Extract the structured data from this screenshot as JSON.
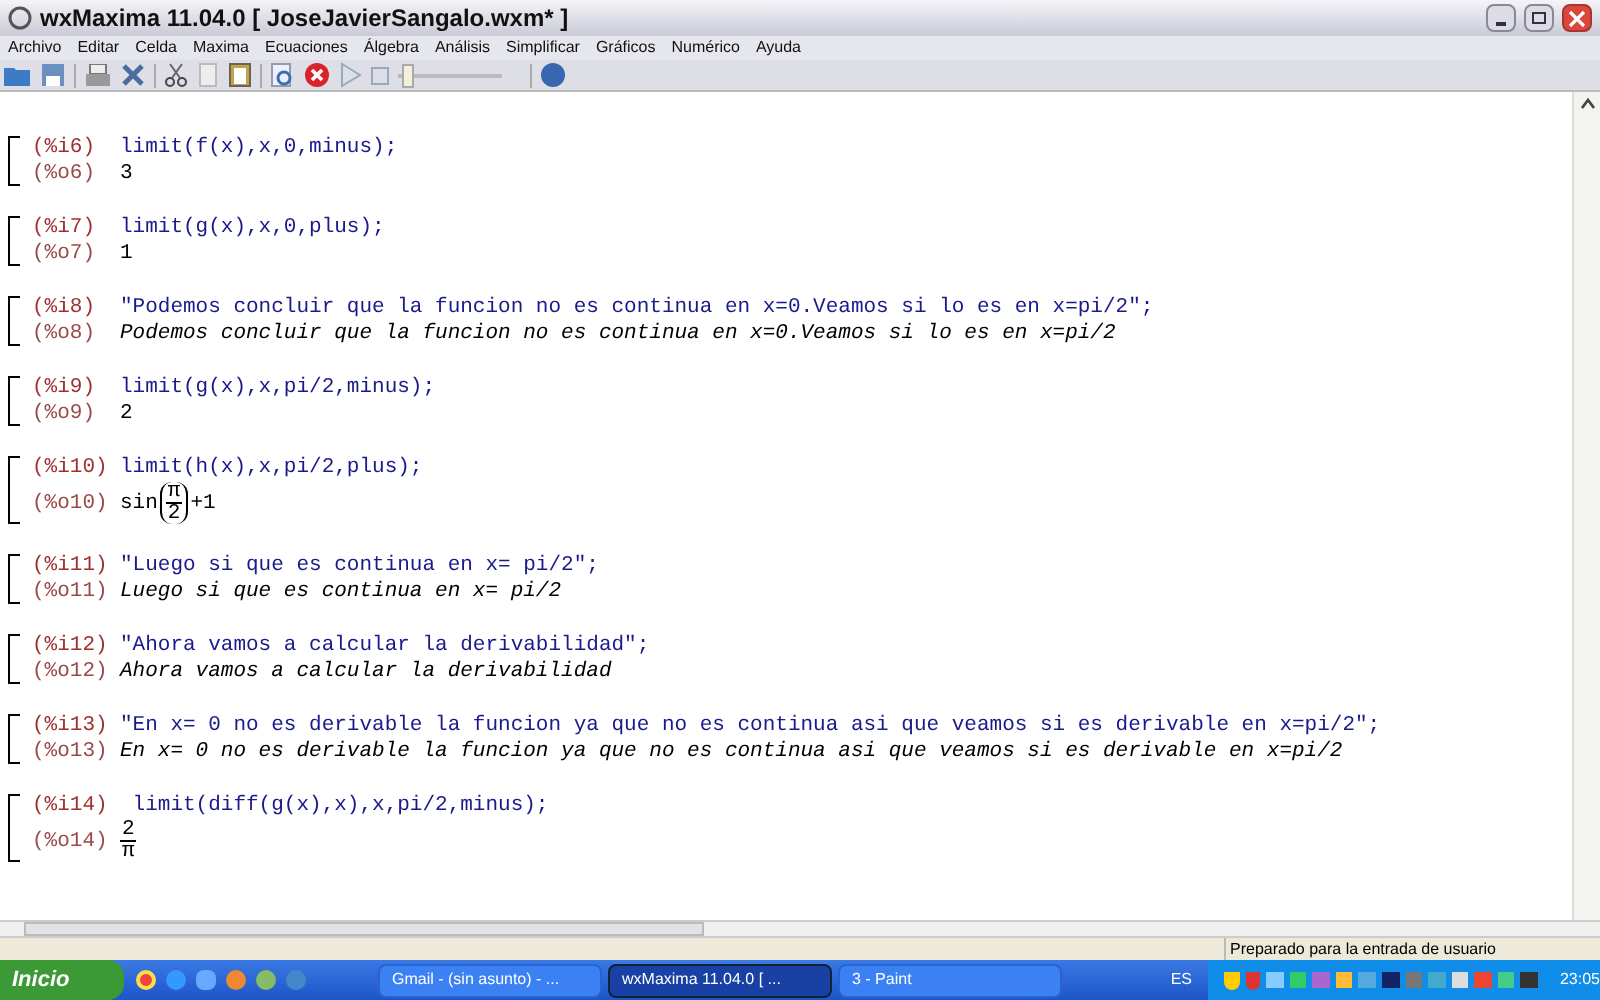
{
  "window": {
    "title": "wxMaxima 11.04.0  [ JoseJavierSangalo.wxm* ]"
  },
  "menu": [
    "Archivo",
    "Editar",
    "Celda",
    "Maxima",
    "Ecuaciones",
    "Álgebra",
    "Análisis",
    "Simplificar",
    "Gráficos",
    "Numérico",
    "Ayuda"
  ],
  "toolbar": {
    "slider": {
      "level": 0.05
    }
  },
  "cells": [
    {
      "input_label": "(%i6)",
      "input": "limit(f(x),x,0,minus);",
      "output_label": "(%o6)",
      "output": [
        {
          "kind": "text",
          "text": "3"
        }
      ]
    },
    {
      "input_label": "(%i7)",
      "input": "limit(g(x),x,0,plus);",
      "output_label": "(%o7)",
      "output": [
        {
          "kind": "text",
          "text": "1"
        }
      ]
    },
    {
      "input_label": "(%i8)",
      "input": "\"Podemos concluir que la funcion no es continua en x=0.Veamos si lo es en x=pi/2\";",
      "output_label": "(%o8)",
      "output": [
        {
          "kind": "string",
          "text": "Podemos concluir que la funcion no es continua en x=0.Veamos si lo es en x=pi/2"
        }
      ]
    },
    {
      "input_label": "(%i9)",
      "input": "limit(g(x),x,pi/2,minus);",
      "output_label": "(%o9)",
      "output": [
        {
          "kind": "text",
          "text": "2"
        }
      ]
    },
    {
      "input_label": "(%i10)",
      "input": "limit(h(x),x,pi/2,plus);",
      "output_label": "(%o10)",
      "output": [
        {
          "kind": "text",
          "text": "sin"
        },
        {
          "kind": "paren_fraction",
          "numerator": "π",
          "denominator": "2"
        },
        {
          "kind": "text",
          "text": "+1"
        }
      ]
    },
    {
      "input_label": "(%i11)",
      "input": "\"Luego si que es continua en x= pi/2\";",
      "output_label": "(%o11)",
      "output": [
        {
          "kind": "string",
          "text": "Luego si que es continua en x= pi/2"
        }
      ]
    },
    {
      "input_label": "(%i12)",
      "input": "\"Ahora vamos a calcular la derivabilidad\";",
      "output_label": "(%o12)",
      "output": [
        {
          "kind": "string",
          "text": "Ahora vamos a calcular la derivabilidad"
        }
      ]
    },
    {
      "input_label": "(%i13)",
      "input": "\"En x= 0 no es derivable la funcion ya que no es continua asi que veamos si es derivable en x=pi/2\";",
      "output_label": "(%o13)",
      "output": [
        {
          "kind": "string",
          "text": "En x= 0 no es derivable la funcion ya que no es continua asi que veamos si es derivable en x=pi/2"
        }
      ]
    },
    {
      "input_label": "(%i14)",
      "input": " limit(diff(g(x),x),x,pi/2,minus);",
      "output_label": "(%o14)",
      "output": [
        {
          "kind": "fraction",
          "numerator": "2",
          "denominator": "π"
        }
      ]
    }
  ],
  "status_bar": "Preparado para la entrada de usuario",
  "taskbar": {
    "start": "Inicio",
    "tasks": [
      {
        "label": "Gmail - (sin asunto) - ...",
        "selected": false
      },
      {
        "label": "wxMaxima 11.04.0 [ ...",
        "selected": true
      },
      {
        "label": "3 - Paint",
        "selected": false
      }
    ],
    "language": "ES",
    "clock": "23:05"
  }
}
